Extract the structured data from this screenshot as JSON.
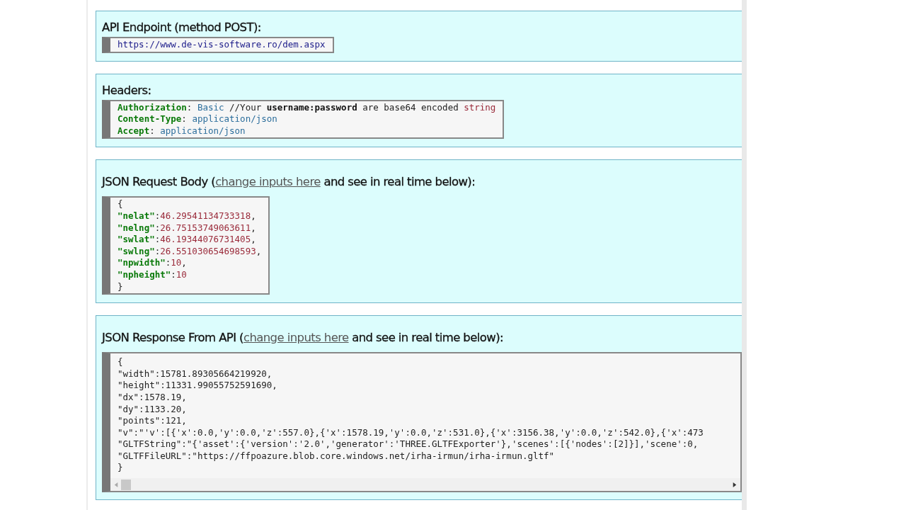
{
  "sections": [
    {
      "heading": {
        "before": "API Endpoint (method POST):"
      },
      "code": {
        "scroll": false,
        "lines": [
          [
            {
              "kind": "url",
              "text": "https://www.de-vis-software.ro/dem.aspx"
            }
          ]
        ]
      }
    },
    {
      "heading": {
        "before": "Headers:"
      },
      "code": {
        "scroll": false,
        "lines": [
          [
            {
              "kind": "key",
              "text": "Authorization"
            },
            {
              "kind": "plain",
              "text": ": "
            },
            {
              "kind": "value",
              "text": "Basic"
            },
            {
              "kind": "plain",
              "text": " //Your "
            },
            {
              "kind": "bold",
              "text": "username:password"
            },
            {
              "kind": "plain",
              "text": " are base64 encoded "
            },
            {
              "kind": "string",
              "text": "string"
            }
          ],
          [
            {
              "kind": "key",
              "text": "Content-Type"
            },
            {
              "kind": "plain",
              "text": ": "
            },
            {
              "kind": "value",
              "text": "application/json"
            }
          ],
          [
            {
              "kind": "key",
              "text": "Accept"
            },
            {
              "kind": "plain",
              "text": ": "
            },
            {
              "kind": "value",
              "text": "application/json"
            }
          ]
        ]
      }
    },
    {
      "heading": {
        "before": "JSON Request Body (",
        "link": "change inputs here",
        "after": " and see in real time below):"
      },
      "code": {
        "scroll": false,
        "lines": [
          [
            {
              "kind": "plain",
              "text": "{"
            }
          ],
          [
            {
              "kind": "key",
              "text": "\"nelat\""
            },
            {
              "kind": "plain",
              "text": ":"
            },
            {
              "kind": "string",
              "text": "46.29541134733318"
            },
            {
              "kind": "plain",
              "text": ","
            }
          ],
          [
            {
              "kind": "key",
              "text": "\"nelng\""
            },
            {
              "kind": "plain",
              "text": ":"
            },
            {
              "kind": "string",
              "text": "26.75153749063611"
            },
            {
              "kind": "plain",
              "text": ","
            }
          ],
          [
            {
              "kind": "key",
              "text": "\"swlat\""
            },
            {
              "kind": "plain",
              "text": ":"
            },
            {
              "kind": "string",
              "text": "46.19344076731405"
            },
            {
              "kind": "plain",
              "text": ","
            }
          ],
          [
            {
              "kind": "key",
              "text": "\"swlng\""
            },
            {
              "kind": "plain",
              "text": ":"
            },
            {
              "kind": "string",
              "text": "26.551030654698593"
            },
            {
              "kind": "plain",
              "text": ","
            }
          ],
          [
            {
              "kind": "key",
              "text": "\"npwidth\""
            },
            {
              "kind": "plain",
              "text": ":"
            },
            {
              "kind": "string",
              "text": "10"
            },
            {
              "kind": "plain",
              "text": ","
            }
          ],
          [
            {
              "kind": "key",
              "text": "\"npheight\""
            },
            {
              "kind": "plain",
              "text": ":"
            },
            {
              "kind": "string",
              "text": "10"
            }
          ],
          [
            {
              "kind": "plain",
              "text": "}"
            }
          ]
        ]
      }
    },
    {
      "heading": {
        "before": "JSON Response From API (",
        "link": "change inputs here",
        "after": " and see in real time below):"
      },
      "code": {
        "scroll": true,
        "lines": [
          [
            {
              "kind": "plain",
              "text": "{"
            }
          ],
          [
            {
              "kind": "plain",
              "text": "\"width\":15781.89305664219920,"
            }
          ],
          [
            {
              "kind": "plain",
              "text": "\"height\":11331.99055752591690,"
            }
          ],
          [
            {
              "kind": "plain",
              "text": "\"dx\":1578.19,"
            }
          ],
          [
            {
              "kind": "plain",
              "text": "\"dy\":1133.20,"
            }
          ],
          [
            {
              "kind": "plain",
              "text": "\"points\":121,"
            }
          ],
          [
            {
              "kind": "plain",
              "text": "\"v\":\"'v':[{'x':0.0,'y':0.0,'z':557.0},{'x':1578.19,'y':0.0,'z':531.0},{'x':3156.38,'y':0.0,'z':542.0},{'x':473"
            }
          ],
          [
            {
              "kind": "plain",
              "text": "\"GLTFString\":\"{'asset':{'version':'2.0','generator':'THREE.GLTFExporter'},'scenes':[{'nodes':[2]}],'scene':0,"
            }
          ],
          [
            {
              "kind": "plain",
              "text": "\"GLTFFileURL\":\"https://ffpoazure.blob.core.windows.net/irha-irmun/irha-irmun.gltf\""
            }
          ],
          [
            {
              "kind": "plain",
              "text": "}"
            }
          ]
        ]
      }
    }
  ]
}
